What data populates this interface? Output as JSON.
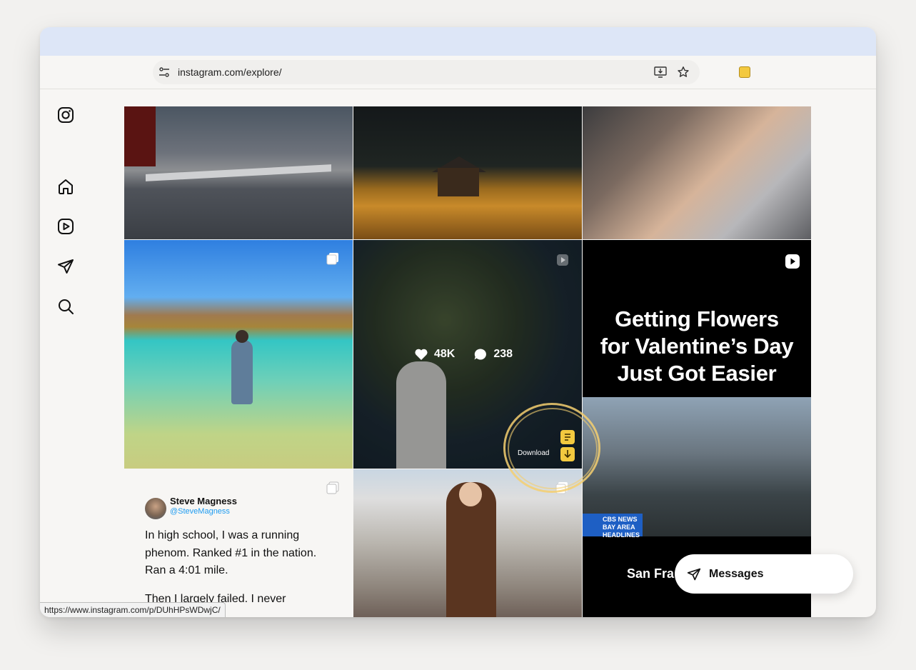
{
  "browser": {
    "url": "instagram.com/explore/",
    "status_url": "https://www.instagram.com/p/DUhHPsWDwjC/"
  },
  "post_overlay": {
    "likes": "48K",
    "comments": "238"
  },
  "extension": {
    "download_label": "Download"
  },
  "video_post": {
    "headline_1": "Getting Flowers",
    "headline_2": "for Valentine’s Day",
    "headline_3": "Just Got Easier",
    "news_brand": "CBS NEWS BAY AREA",
    "news_sub": "HEADLINES",
    "caption": "San Fra"
  },
  "tweet_post": {
    "name": "Steve Magness",
    "handle": "@SteveMagness",
    "para1": "In high school, I was a running phenom. Ranked #1 in the nation. Ran a 4:01 mile.",
    "para2": "Then I largely failed. I never"
  },
  "messages": {
    "label": "Messages"
  },
  "colors": {
    "accent": "#f3c93f",
    "titlebar": "#dde6f7",
    "news_blue": "#1e5fc4",
    "handle_blue": "#1d9bf0"
  }
}
